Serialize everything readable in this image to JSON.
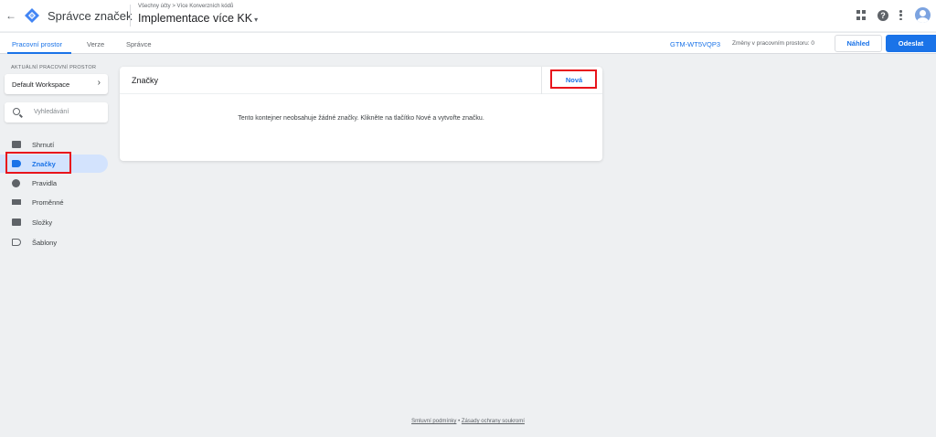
{
  "header": {
    "app_title": "Správce značek",
    "breadcrumb": "Všechny účty > Více Konverzních kódů",
    "container_name": "Implementace více KK",
    "caret": "▾"
  },
  "tabs": [
    {
      "label": "Pracovní prostor",
      "active": true
    },
    {
      "label": "Verze",
      "active": false
    },
    {
      "label": "Správce",
      "active": false
    }
  ],
  "toolbar": {
    "container_id": "GTM-WT5VQP3",
    "changes_text": "Změny v pracovním prostoru: 0",
    "preview_label": "Náhled",
    "submit_label": "Odeslat"
  },
  "sidebar": {
    "workspace_label": "AKTUÁLNÍ PRACOVNÍ PROSTOR",
    "workspace_name": "Default Workspace",
    "search_placeholder": "Vyhledávání",
    "items": [
      {
        "label": "Shrnutí",
        "icon": "summary-icon"
      },
      {
        "label": "Značky",
        "icon": "tag-icon",
        "active": true
      },
      {
        "label": "Pravidla",
        "icon": "trigger-icon"
      },
      {
        "label": "Proměnné",
        "icon": "variables-icon"
      },
      {
        "label": "Složky",
        "icon": "folder-icon"
      },
      {
        "label": "Šablony",
        "icon": "template-icon"
      }
    ]
  },
  "card": {
    "title": "Značky",
    "new_label": "Nová",
    "empty_message": "Tento kontejner neobsahuje žádné značky. Klikněte na tlačítko Nové a vytvořte značku."
  },
  "footer": {
    "terms": "Smluvní podmínky",
    "separator": "•",
    "privacy": "Zásady ochrany soukromí"
  },
  "colors": {
    "accent": "#1a73e8",
    "highlight": "#e8141c",
    "background": "#eef0f2"
  }
}
